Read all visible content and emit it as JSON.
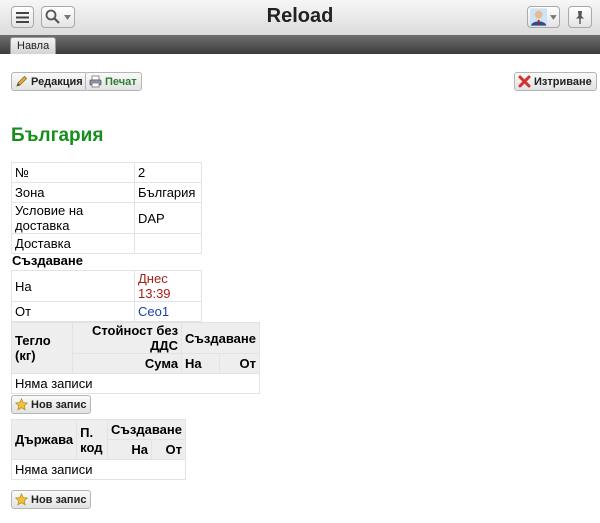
{
  "header": {
    "app_title": "Reload",
    "tab_label": "Навла",
    "menu_icon": "hamburger-icon",
    "search_icon": "search-icon",
    "pin_icon": "pin-icon"
  },
  "toolbar": {
    "edit_label": "Редакция",
    "print_label": "Печат",
    "delete_label": "Изтриване"
  },
  "page": {
    "title": "България"
  },
  "info_table": [
    {
      "label": "№",
      "value": "2"
    },
    {
      "label": "Зона",
      "value": "България"
    },
    {
      "label": "Условие на доставка",
      "value": "DAP"
    },
    {
      "label": "Доставка",
      "value": ""
    }
  ],
  "created_section": {
    "heading": "Създаване",
    "rows": [
      {
        "label": "На",
        "value": "Днес 13:39"
      },
      {
        "label": "От",
        "value": "Ceo1"
      }
    ]
  },
  "weights_table": {
    "col_weight": "Тегло (кг)",
    "col_value": "Стойност без ДДС",
    "col_value_sub": "Сума",
    "col_created": "Създаване",
    "col_created_on": "На",
    "col_created_by": "От",
    "empty_text": "Няма записи",
    "new_label": "Нов запис"
  },
  "countries_table": {
    "col_country": "Държава",
    "col_postcode": "П. код",
    "col_created": "Създаване",
    "col_created_on": "На",
    "col_created_by": "От",
    "empty_text": "Няма записи",
    "new_label": "Нов запис"
  },
  "colors": {
    "title_green": "#178f1c",
    "date_red": "#a8201a",
    "user_blue": "#1a3fb0"
  }
}
